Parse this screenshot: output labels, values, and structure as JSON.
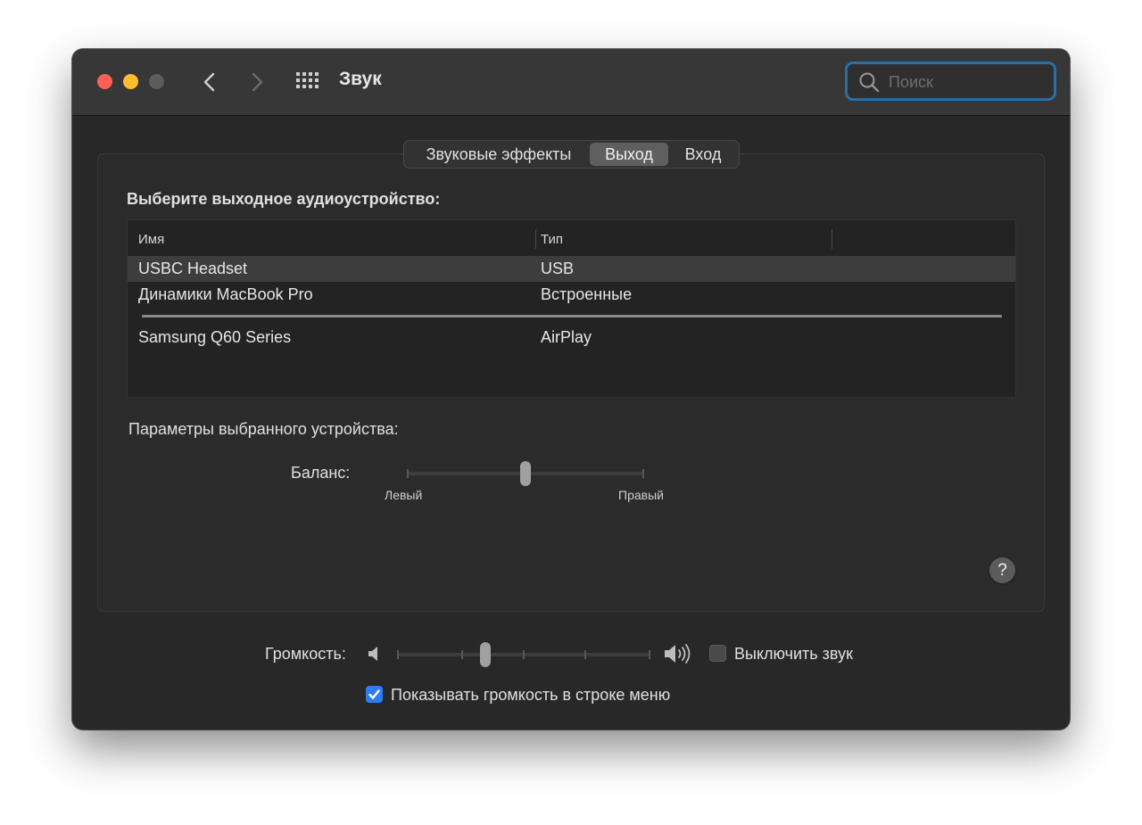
{
  "window": {
    "title": "Звук",
    "search_placeholder": "Поиск"
  },
  "tabs": [
    {
      "label": "Звуковые эффекты",
      "selected": false
    },
    {
      "label": "Выход",
      "selected": true
    },
    {
      "label": "Вход",
      "selected": false
    }
  ],
  "output": {
    "heading": "Выберите выходное аудиоустройство:",
    "columns": {
      "name": "Имя",
      "type": "Тип"
    },
    "devices": [
      {
        "name": "USBC Headset",
        "type": "USB",
        "selected": true
      },
      {
        "name": "Динамики MacBook Pro",
        "type": "Встроенные",
        "selected": false
      },
      {
        "name": "Samsung Q60 Series",
        "type": "AirPlay",
        "selected": false
      }
    ]
  },
  "device_settings": {
    "heading": "Параметры выбранного устройства:",
    "balance_label": "Баланс:",
    "balance_left": "Левый",
    "balance_right": "Правый",
    "balance_value": 0.5
  },
  "help_label": "?",
  "volume": {
    "label": "Громкость:",
    "value": 0.35,
    "mute_label": "Выключить звук",
    "muted": false,
    "show_in_menu_label": "Показывать громкость в строке меню",
    "show_in_menu": true
  },
  "colors": {
    "accent": "#2c7ef0",
    "search_focus": "#2b6ea6",
    "close": "#fe5f57",
    "minimize": "#febc2e"
  }
}
